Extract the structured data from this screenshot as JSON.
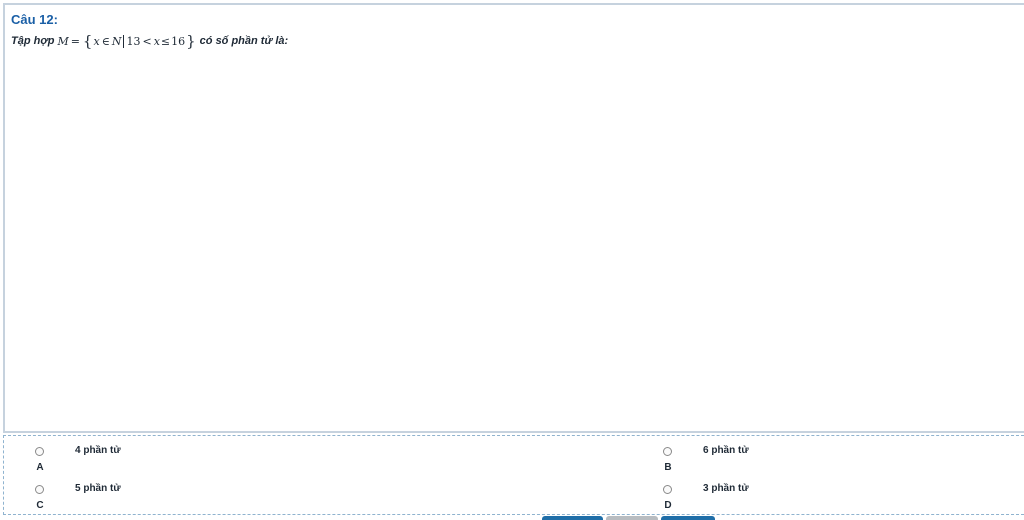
{
  "question": {
    "title": "Câu 12:",
    "prefix": "Tập hợp",
    "math": {
      "var_m": "M",
      "eq": "=",
      "brace_open": "{",
      "var_x": "x",
      "in": "∈",
      "set_n": "N",
      "lower": "13",
      "lt": "<",
      "var_x2": "x",
      "le": "≤",
      "upper": "16",
      "brace_close": "}"
    },
    "suffix": "có số phần tử là:"
  },
  "answers": [
    {
      "letter": "A",
      "text": "4 phần tử"
    },
    {
      "letter": "B",
      "text": "6 phần tử"
    },
    {
      "letter": "C",
      "text": "5 phần tử"
    },
    {
      "letter": "D",
      "text": "3 phần tử"
    }
  ],
  "colors": {
    "title": "#1a5fa6",
    "button_primary": "#1f6ea8",
    "button_secondary": "#b8bcc0"
  }
}
